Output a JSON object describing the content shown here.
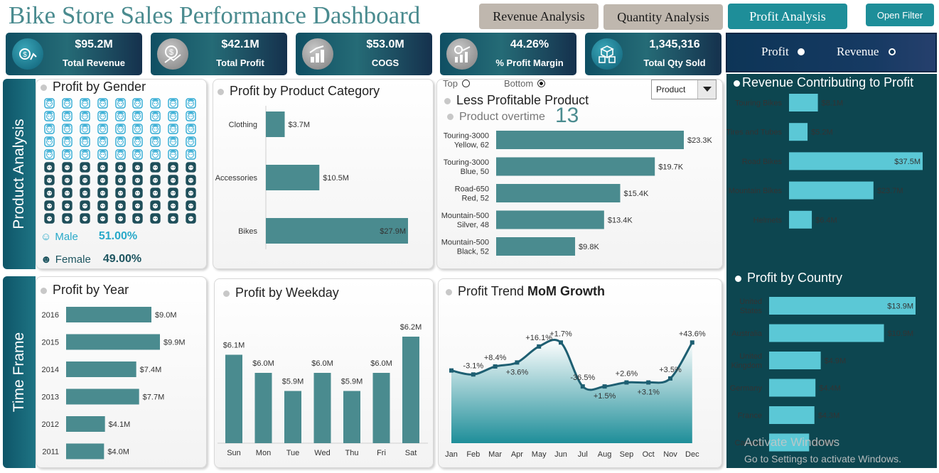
{
  "title": "Bike Store Sales Performance Dashboard",
  "buttons": {
    "revenue": "Revenue Analysis",
    "quantity": "Quantity Analysis",
    "profit": "Profit Analysis",
    "filter": "Open Filter"
  },
  "kpis": [
    {
      "value": "$95.2M",
      "label": "Total Revenue",
      "icon": "revenue-icon"
    },
    {
      "value": "$42.1M",
      "label": "Total Profit",
      "icon": "dollar-growth-icon"
    },
    {
      "value": "$53.0M",
      "label": "COGS",
      "icon": "bar-growth-icon"
    },
    {
      "value": "44.26%",
      "label": "% Profit Margin",
      "icon": "money-chart-icon"
    },
    {
      "value": "1,345,316",
      "label": "Total Qty Sold",
      "icon": "boxes-icon"
    }
  ],
  "metric_toggle": {
    "option_a": "Profit",
    "option_b": "Revenue",
    "selected": "Profit"
  },
  "side_labels": {
    "product": "Product Analysis",
    "time": "Time Frame"
  },
  "gender": {
    "title": "Profit by Gender",
    "male_label": "Male",
    "male_pct": "51.00%",
    "female_label": "Female",
    "female_pct": "49.00%",
    "male_share": 0.51
  },
  "category": {
    "title": "Profit by Product Category",
    "chart_data": {
      "type": "bar",
      "categories": [
        "Clothing",
        "Accessories",
        "Bikes"
      ],
      "values": [
        3.7,
        10.5,
        27.9
      ],
      "labels": [
        "$3.7M",
        "$10.5M",
        "$27.9M"
      ]
    }
  },
  "products": {
    "top_label": "Top",
    "bottom_label": "Bottom",
    "selected": "Bottom",
    "dropdown": "Product",
    "title": "Less Profitable Product",
    "subtitle": "Product overtime",
    "count": "13",
    "chart_data": {
      "type": "bar",
      "categories": [
        [
          "Touring-3000",
          "Yellow, 62"
        ],
        [
          "Touring-3000",
          "Blue, 50"
        ],
        [
          "Road-650",
          "Red, 52"
        ],
        [
          "Mountain-500",
          "Silver, 48"
        ],
        [
          "Mountain-500",
          "Black, 52"
        ]
      ],
      "values": [
        23.3,
        19.7,
        15.4,
        13.4,
        9.8
      ],
      "labels": [
        "$23.3K",
        "$19.7K",
        "$15.4K",
        "$13.4K",
        "$9.8K"
      ]
    }
  },
  "revenue_contrib": {
    "title": "Revenue Contributing to Profit",
    "chart_data": {
      "type": "bar",
      "categories": [
        "Touring Bikes",
        "Tires and Tubes",
        "Road Bikes",
        "Mountain Bikes",
        "Helmets"
      ],
      "values": [
        8.1,
        5.2,
        37.5,
        23.7,
        6.4
      ],
      "labels": [
        "$8.1M",
        "$5.2M",
        "$37.5M",
        "$23.7M",
        "$6.4M"
      ]
    }
  },
  "year": {
    "title": "Profit by Year",
    "chart_data": {
      "type": "bar",
      "categories": [
        "2016",
        "2015",
        "2014",
        "2013",
        "2012",
        "2011"
      ],
      "values": [
        9.0,
        9.9,
        7.4,
        7.7,
        4.1,
        4.0
      ],
      "labels": [
        "$9.0M",
        "$9.9M",
        "$7.4M",
        "$7.7M",
        "$4.1M",
        "$4.0M"
      ]
    }
  },
  "weekday": {
    "title": "Profit by Weekday",
    "chart_data": {
      "type": "bar",
      "categories": [
        "Sun",
        "Mon",
        "Tue",
        "Wed",
        "Thu",
        "Fri",
        "Sat"
      ],
      "values": [
        6.1,
        6.0,
        5.9,
        6.0,
        5.9,
        6.0,
        6.2
      ],
      "labels": [
        "$6.1M",
        "$6.0M",
        "$5.9M",
        "$6.0M",
        "$5.9M",
        "$6.0M",
        "$6.2M"
      ]
    }
  },
  "trend": {
    "title_a": "Profit Trend ",
    "title_b": "MoM Growth",
    "chart_data": {
      "type": "area",
      "categories": [
        "Jan",
        "Feb",
        "Mar",
        "Apr",
        "May",
        "Jun",
        "Jul",
        "Aug",
        "Sep",
        "Oct",
        "Nov",
        "Dec"
      ],
      "values": [
        2.3,
        2.2,
        2.4,
        2.5,
        2.9,
        3.0,
        1.9,
        1.9,
        2.0,
        2.0,
        2.1,
        3.0
      ],
      "growth_labels": [
        "",
        "-3.1%",
        "+8.4%",
        "+3.6%",
        "+16.1%",
        "+1.7%",
        "-36.5%",
        "+1.5%",
        "+2.6%",
        "+3.1%",
        "+3.5%",
        "+43.6%"
      ]
    }
  },
  "country": {
    "title": "Profit by Country",
    "chart_data": {
      "type": "bar",
      "categories": [
        [
          "United",
          "States"
        ],
        [
          "Australia"
        ],
        [
          "United",
          "Kingdom"
        ],
        [
          "Germany"
        ],
        [
          "France"
        ],
        [
          "Canada"
        ]
      ],
      "values": [
        13.9,
        10.9,
        4.9,
        4.4,
        4.3,
        3.8
      ],
      "labels": [
        "$13.9M",
        "$10.9M",
        "$4.9M",
        "$4.4M",
        "$4.3M",
        "$3.8M"
      ]
    }
  },
  "watermark": {
    "line1": "Activate Windows",
    "line2": "Go to Settings to activate Windows."
  },
  "colors": {
    "bar_teal": "#4a8b8f",
    "bar_cyan": "#5bc8d6",
    "line": "#1e5f72",
    "dark_panel": "#0d4650"
  }
}
